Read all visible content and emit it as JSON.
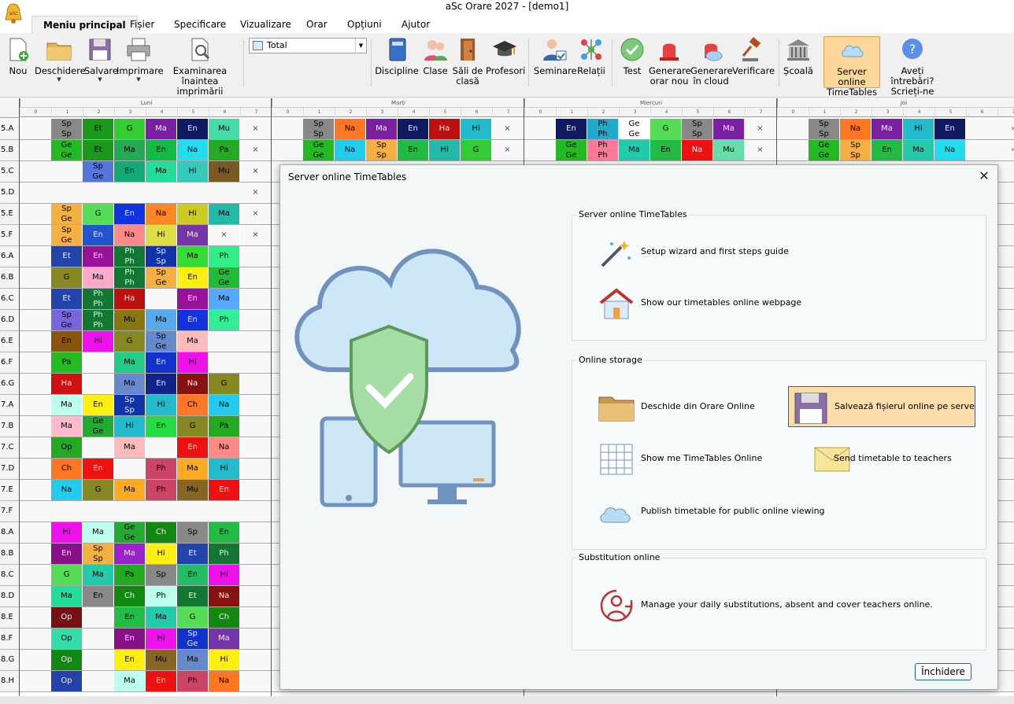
{
  "window": {
    "title": "aSc Orare 2027  - [demo1]"
  },
  "menu_tabs": [
    {
      "label": "Meniu principal",
      "active": true
    },
    {
      "label": "Fișier"
    },
    {
      "label": "Specificare"
    },
    {
      "label": "Vizualizare"
    },
    {
      "label": "Orar"
    },
    {
      "label": "Opțiuni"
    },
    {
      "label": "Ajutor"
    }
  ],
  "ribbon": {
    "nou": "Nou",
    "deschidere": "Deschidere",
    "salvare": "Salvare",
    "imprimare": "Imprimare",
    "examinarea_line1": "Examinarea",
    "examinarea_line2": "înaintea imprimării",
    "view_select": "Total",
    "discipline": "Discipline",
    "clase": "Clase",
    "sali_line1": "Săli de",
    "sali_line2": "clasă",
    "profesori": "Profesori",
    "seminare": "Seminare",
    "relatii": "Relații",
    "test": "Test",
    "gen_orar_line1": "Generare",
    "gen_orar_line2": "orar nou",
    "gen_cloud_line1": "Generare",
    "gen_cloud_line2": "în cloud",
    "verificare": "Verificare",
    "scoala": "Școală",
    "server_line1": "Server online",
    "server_line2": "TimeTables",
    "intrebari_line1": "Aveți întrebări?",
    "intrebari_line2": "Scrieți-ne"
  },
  "grid": {
    "days": [
      "Luni",
      "Marți",
      "Miercuri",
      "Joi"
    ],
    "periods": [
      "0",
      "1",
      "2",
      "3",
      "4",
      "5",
      "6",
      "7"
    ],
    "rows": [
      {
        "label": "5.A",
        "cells": [
          [
            "Sp/Sp",
            "#888888"
          ],
          [
            "Et",
            "#1a9a1a"
          ],
          [
            "G",
            "#33cc33"
          ],
          [
            "Ma",
            "#7a1fa2"
          ],
          [
            "En",
            "#101a60"
          ],
          [
            "Mu",
            "#44ddaa"
          ],
          [
            "x",
            ""
          ]
        ]
      },
      {
        "label": "5.B",
        "cells": [
          [
            "Ge/Ge",
            "#22bb22"
          ],
          [
            "Et",
            "#1a9a1a"
          ],
          [
            "Ma",
            "#22aa55"
          ],
          [
            "En",
            "#11bb44"
          ],
          [
            "Na",
            "#22ddee"
          ],
          [
            "Pa",
            "#22aa22"
          ],
          [
            "x",
            ""
          ]
        ]
      },
      {
        "label": "5.C",
        "cells": [
          [
            "",
            ""
          ],
          [
            "Sp/Ge",
            "#5577dd"
          ],
          [
            "En",
            "#11aa77"
          ],
          [
            "Ma",
            "#22dd99"
          ],
          [
            "Hi",
            "#33ccbb"
          ],
          [
            "Mu",
            "#7a5a22"
          ],
          [
            "x",
            ""
          ]
        ]
      },
      {
        "label": "5.D",
        "cells": [
          [
            "",
            ""
          ],
          [
            "",
            ""
          ],
          [
            "",
            ""
          ],
          [
            "",
            ""
          ],
          [
            "",
            ""
          ],
          [
            "",
            ""
          ],
          [
            "x",
            ""
          ]
        ]
      },
      {
        "label": "5.E",
        "cells": [
          [
            "Sp/Ge",
            "#f4b040"
          ],
          [
            "G",
            "#55dd55"
          ],
          [
            "En",
            "#1133dd"
          ],
          [
            "Na",
            "#ff8822"
          ],
          [
            "Hi",
            "#cccc22"
          ],
          [
            "Ma",
            "#22bbaa"
          ],
          [
            "x",
            ""
          ]
        ]
      },
      {
        "label": "5.F",
        "cells": [
          [
            "Sp/Ge",
            "#f4b040"
          ],
          [
            "En",
            "#2255cc"
          ],
          [
            "Na",
            "#ff8888"
          ],
          [
            "Hi",
            "#dddd44"
          ],
          [
            "Ma",
            "#7733aa"
          ],
          [
            "x",
            ""
          ],
          [
            "x",
            ""
          ]
        ]
      },
      {
        "label": "6.A",
        "cells": [
          [
            "Et",
            "#2244aa"
          ],
          [
            "En",
            "#991199"
          ],
          [
            "Ph/Ph",
            "#117733"
          ],
          [
            "Sp/Sp",
            "#1133aa"
          ],
          [
            "Ma",
            "#33dd33"
          ],
          [
            "Ph",
            "#33ee88"
          ],
          [
            "",
            ""
          ]
        ]
      },
      {
        "label": "6.B",
        "cells": [
          [
            "G",
            "#888822"
          ],
          [
            "Ma",
            "#ffaacc"
          ],
          [
            "Ph/Ph",
            "#117733"
          ],
          [
            "Sp/Ge",
            "#f4b040"
          ],
          [
            "En",
            "#ffee11"
          ],
          [
            "Ge/Ge",
            "#22bb33"
          ],
          [
            "",
            ""
          ]
        ]
      },
      {
        "label": "6.C",
        "cells": [
          [
            "Et",
            "#2244aa"
          ],
          [
            "Ph/Ph",
            "#117733"
          ],
          [
            "Ha",
            "#bb1111"
          ],
          [
            "",
            ""
          ],
          [
            "En",
            "#991199"
          ],
          [
            "Ma",
            "#55aaff"
          ],
          [
            "",
            ""
          ]
        ]
      },
      {
        "label": "6.D",
        "cells": [
          [
            "Sp/Ge",
            "#7766dd"
          ],
          [
            "Ph/Ph",
            "#117733"
          ],
          [
            "Mu",
            "#887711"
          ],
          [
            "Ma",
            "#55aaee"
          ],
          [
            "En",
            "#1133dd"
          ],
          [
            "Ph",
            "#33ee99"
          ],
          [
            "",
            ""
          ]
        ]
      },
      {
        "label": "6.E",
        "cells": [
          [
            "En",
            "#885511"
          ],
          [
            "Hi",
            "#ee11ee"
          ],
          [
            "G",
            "#888822"
          ],
          [
            "Sp/Ge",
            "#6688cc"
          ],
          [
            "Ma",
            "#ffbbbb"
          ],
          [
            "",
            ""
          ],
          [
            "",
            ""
          ]
        ]
      },
      {
        "label": "6.F",
        "cells": [
          [
            "Pa",
            "#22bb22"
          ],
          [
            "",
            ""
          ],
          [
            "Ma",
            "#22cc88"
          ],
          [
            "En",
            "#1133cc"
          ],
          [
            "Hi",
            "#ee11ee"
          ],
          [
            "",
            ""
          ],
          [
            "",
            ""
          ]
        ]
      },
      {
        "label": "6.G",
        "cells": [
          [
            "Ha",
            "#cc1111"
          ],
          [
            "",
            ""
          ],
          [
            "Ma",
            "#6688cc"
          ],
          [
            "En",
            "#112288"
          ],
          [
            "Na",
            "#881111"
          ],
          [
            "G",
            "#888822"
          ],
          [
            "",
            ""
          ]
        ]
      },
      {
        "label": "7.A",
        "cells": [
          [
            "Ma",
            "#bbffee"
          ],
          [
            "En",
            "#ffee11"
          ],
          [
            "Sp/Sp",
            "#1133aa"
          ],
          [
            "Hi",
            "#22bbcc"
          ],
          [
            "Ch",
            "#ff7722"
          ],
          [
            "Na",
            "#22ccee"
          ],
          [
            "",
            ""
          ]
        ]
      },
      {
        "label": "7.B",
        "cells": [
          [
            "Ma",
            "#ffbbcc"
          ],
          [
            "Ge/Ge",
            "#22aa33"
          ],
          [
            "Hi",
            "#22bbcc"
          ],
          [
            "En",
            "#22dd44"
          ],
          [
            "G",
            "#888822"
          ],
          [
            "Pa",
            "#22aa22"
          ],
          [
            "",
            ""
          ]
        ]
      },
      {
        "label": "7.C",
        "cells": [
          [
            "Op",
            "#22aa22"
          ],
          [
            "",
            ""
          ],
          [
            "Ma",
            "#ffbbbb"
          ],
          [
            "",
            ""
          ],
          [
            "En",
            "#ee1111"
          ],
          [
            "Na",
            "#ff8888"
          ],
          [
            "",
            ""
          ]
        ]
      },
      {
        "label": "7.D",
        "cells": [
          [
            "Ch",
            "#ff7722"
          ],
          [
            "En",
            "#ee1111"
          ],
          [
            "",
            ""
          ],
          [
            "Ph",
            "#cc4466"
          ],
          [
            "Ma",
            "#ffaa22"
          ],
          [
            "Hi",
            "#22bbcc"
          ],
          [
            "",
            ""
          ]
        ]
      },
      {
        "label": "7.E",
        "cells": [
          [
            "Na",
            "#22ccee"
          ],
          [
            "G",
            "#888822"
          ],
          [
            "Ma",
            "#ffaa22"
          ],
          [
            "Ph",
            "#cc4466"
          ],
          [
            "Mu",
            "#886622"
          ],
          [
            "En",
            "#ee1111"
          ],
          [
            "",
            ""
          ]
        ]
      },
      {
        "label": "7.F",
        "cells": [
          [
            "",
            ""
          ],
          [
            "",
            ""
          ],
          [
            "",
            ""
          ],
          [
            "",
            ""
          ],
          [
            "",
            ""
          ],
          [
            "",
            ""
          ],
          [
            "",
            ""
          ]
        ]
      },
      {
        "label": "8.A",
        "cells": [
          [
            "Hi",
            "#ee11ee"
          ],
          [
            "Ma",
            "#bbffee"
          ],
          [
            "Ge/Ge",
            "#22aa33"
          ],
          [
            "Ch",
            "#118811"
          ],
          [
            "Sp",
            "#888888"
          ],
          [
            "En",
            "#22bb44"
          ],
          [
            "",
            ""
          ]
        ]
      },
      {
        "label": "8.B",
        "cells": [
          [
            "En",
            "#881188"
          ],
          [
            "Sp/Sp",
            "#f4b040"
          ],
          [
            "Ma",
            "#9922cc"
          ],
          [
            "Hi",
            "#ffee11"
          ],
          [
            "Et",
            "#2244aa"
          ],
          [
            "Ph",
            "#117733"
          ],
          [
            "",
            ""
          ]
        ]
      },
      {
        "label": "8.C",
        "cells": [
          [
            "G",
            "#55dd55"
          ],
          [
            "Ma",
            "#22ccaa"
          ],
          [
            "Pa",
            "#22aa22"
          ],
          [
            "Sp",
            "#888888"
          ],
          [
            "En",
            "#22bb66"
          ],
          [
            "Hi",
            "#ee11ee"
          ],
          [
            "",
            ""
          ]
        ]
      },
      {
        "label": "8.D",
        "cells": [
          [
            "Ma",
            "#22dd99"
          ],
          [
            "En",
            "#888888"
          ],
          [
            "Ch",
            "#118811"
          ],
          [
            "Ph",
            "#bbffee"
          ],
          [
            "Et",
            "#117733"
          ],
          [
            "Na",
            "#881111"
          ],
          [
            "",
            ""
          ]
        ]
      },
      {
        "label": "8.E",
        "cells": [
          [
            "Op",
            "#771111"
          ],
          [
            "",
            ""
          ],
          [
            "En",
            "#22bb44"
          ],
          [
            "Ma",
            "#22ccaa"
          ],
          [
            "G",
            "#55dd55"
          ],
          [
            "Ch",
            "#118811"
          ],
          [
            "",
            ""
          ]
        ]
      },
      {
        "label": "8.F",
        "cells": [
          [
            "Op",
            "#33ddaa"
          ],
          [
            "",
            ""
          ],
          [
            "En",
            "#881188"
          ],
          [
            "Hi",
            "#ee11ee"
          ],
          [
            "Sp/Ge",
            "#1133cc"
          ],
          [
            "Ma",
            "#7733aa"
          ],
          [
            "",
            ""
          ]
        ]
      },
      {
        "label": "8.G",
        "cells": [
          [
            "Op",
            "#118811"
          ],
          [
            "",
            ""
          ],
          [
            "En",
            "#ffee11"
          ],
          [
            "Mu",
            "#886622"
          ],
          [
            "Ma",
            "#6688cc"
          ],
          [
            "Hi",
            "#ffee11"
          ],
          [
            "",
            ""
          ]
        ]
      },
      {
        "label": "8.H",
        "cells": [
          [
            "Op",
            "#2244aa"
          ],
          [
            "",
            ""
          ],
          [
            "Ma",
            "#bbffee"
          ],
          [
            "En",
            "#ee1111"
          ],
          [
            "Ph",
            "#cc4466"
          ],
          [
            "Na",
            "#ff7722"
          ],
          [
            "",
            ""
          ]
        ]
      }
    ],
    "tuesday_rows": [
      [
        [
          "Sp/Sp",
          "#888888"
        ],
        [
          "Na",
          "#ff7722"
        ],
        [
          "Ma",
          "#7a1fa2"
        ],
        [
          "En",
          "#101a60"
        ],
        [
          "Ha",
          "#bb1111"
        ],
        [
          "Hi",
          "#22bbcc"
        ],
        [
          "x",
          ""
        ]
      ],
      [
        [
          "Ge/Ge",
          "#22bb22"
        ],
        [
          "Na",
          "#22ccee"
        ],
        [
          "Sp/Sp",
          "#f4b040"
        ],
        [
          "En",
          "#22bb44"
        ],
        [
          "Hi",
          "#22bbaa"
        ],
        [
          "G",
          "#33cc33"
        ],
        [
          "x",
          ""
        ]
      ]
    ],
    "wednesday_rows": [
      [
        [
          "En",
          "#101a60"
        ],
        [
          "Ph/Ph",
          "#22aacc"
        ],
        [
          "Ge/Ge",
          "#ffffff"
        ],
        [
          "G",
          "#55dd55"
        ],
        [
          "Sp/Sp",
          "#888888"
        ],
        [
          "Ma",
          "#7a1fa2"
        ],
        [
          "x",
          ""
        ]
      ],
      [
        [
          "Ge/Ge",
          "#22bb22"
        ],
        [
          "Ph/Ph",
          "#ff7799"
        ],
        [
          "Ma",
          "#22ccaa"
        ],
        [
          "En",
          "#22bb44"
        ],
        [
          "Na",
          "#ee1111"
        ],
        [
          "Mu",
          "#66ddaa"
        ],
        [
          "x",
          ""
        ]
      ]
    ],
    "thursday_rows": [
      [
        [
          "Sp/Sp",
          "#888888"
        ],
        [
          "Na",
          "#ff7722"
        ],
        [
          "Ma",
          "#7a1fa2"
        ],
        [
          "Hi",
          "#22bbcc"
        ],
        [
          "En",
          "#101a60"
        ],
        [
          "",
          ""
        ],
        [
          ">",
          ""
        ]
      ],
      [
        [
          "Ge/Ge",
          "#22bb22"
        ],
        [
          "Sp/Sp",
          "#f4b040"
        ],
        [
          "En",
          "#22bb44"
        ],
        [
          "Ma",
          "#22ccaa"
        ],
        [
          "Na",
          "#22ddee"
        ],
        [
          "",
          ""
        ],
        [
          ">",
          ""
        ]
      ]
    ]
  },
  "dialog": {
    "title": "Server online TimeTables",
    "groups": {
      "server": {
        "label": "Server online TimeTables",
        "items": [
          "Setup wizard and first steps guide",
          "Show our timetables online webpage"
        ]
      },
      "storage": {
        "label": "Online storage",
        "items": [
          "Deschide din Orare Online",
          "Salvează fișierul online pe serverul Ti",
          "Show me TimeTables Online",
          "Send timetable to teachers",
          "Publish timetable for public online viewing"
        ]
      },
      "substitution": {
        "label": "Substitution online",
        "items": [
          "Manage your daily substitutions, absent and cover teachers online."
        ]
      }
    },
    "close_button": "Închidere"
  }
}
